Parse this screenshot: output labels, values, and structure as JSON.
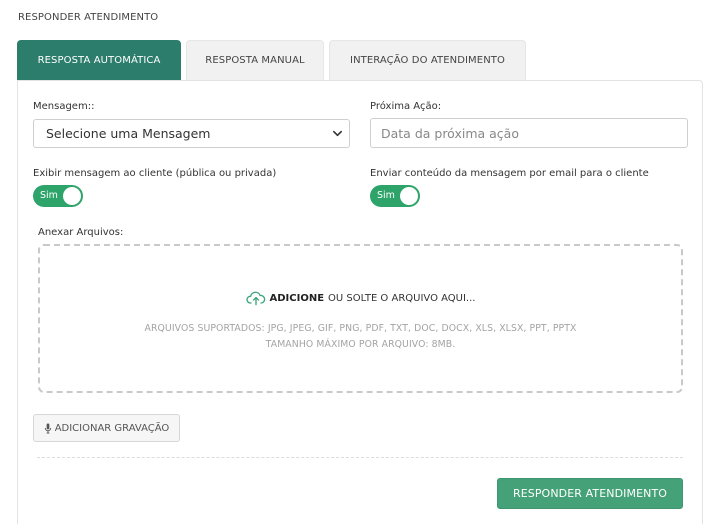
{
  "page": {
    "title": "RESPONDER ATENDIMENTO"
  },
  "tabs": [
    {
      "label": "RESPOSTA AUTOMÁTICA",
      "active": true
    },
    {
      "label": "RESPOSTA MANUAL",
      "active": false
    },
    {
      "label": "INTERAÇÃO DO ATENDIMENTO",
      "active": false
    }
  ],
  "form": {
    "mensagem_label": "Mensagem::",
    "mensagem_selected": "Selecione uma Mensagem",
    "proxima_acao_label": "Próxima Ação:",
    "proxima_acao_placeholder": "Data da próxima ação",
    "proxima_acao_value": "",
    "exibir_label": "Exibir mensagem ao cliente (pública ou privada)",
    "exibir_toggle": "Sim",
    "enviar_label": "Enviar conteúdo da mensagem por email para o cliente",
    "enviar_toggle": "Sim",
    "anexar_label": "Anexar Arquivos:"
  },
  "dropzone": {
    "icon": "cloud-upload-icon",
    "action_bold": "ADICIONE",
    "action_rest": "OU SOLTE O ARQUIVO AQUI...",
    "supported": "ARQUIVOS SUPORTADOS: JPG, JPEG, GIF, PNG, PDF, TXT, DOC, DOCX, XLS, XLSX, PPT, PPTX",
    "max_size": "TAMANHO MÁXIMO POR ARQUIVO: 8MB."
  },
  "buttons": {
    "record_icon": "microphone-icon",
    "record_label": "ADICIONAR GRAVAÇÃO",
    "submit_label": "RESPONDER ATENDIMENTO"
  },
  "colors": {
    "tab_active": "#2d7d6c",
    "toggle_on": "#2ea36a",
    "submit": "#45a178",
    "upload_icon": "#3aa57a"
  }
}
